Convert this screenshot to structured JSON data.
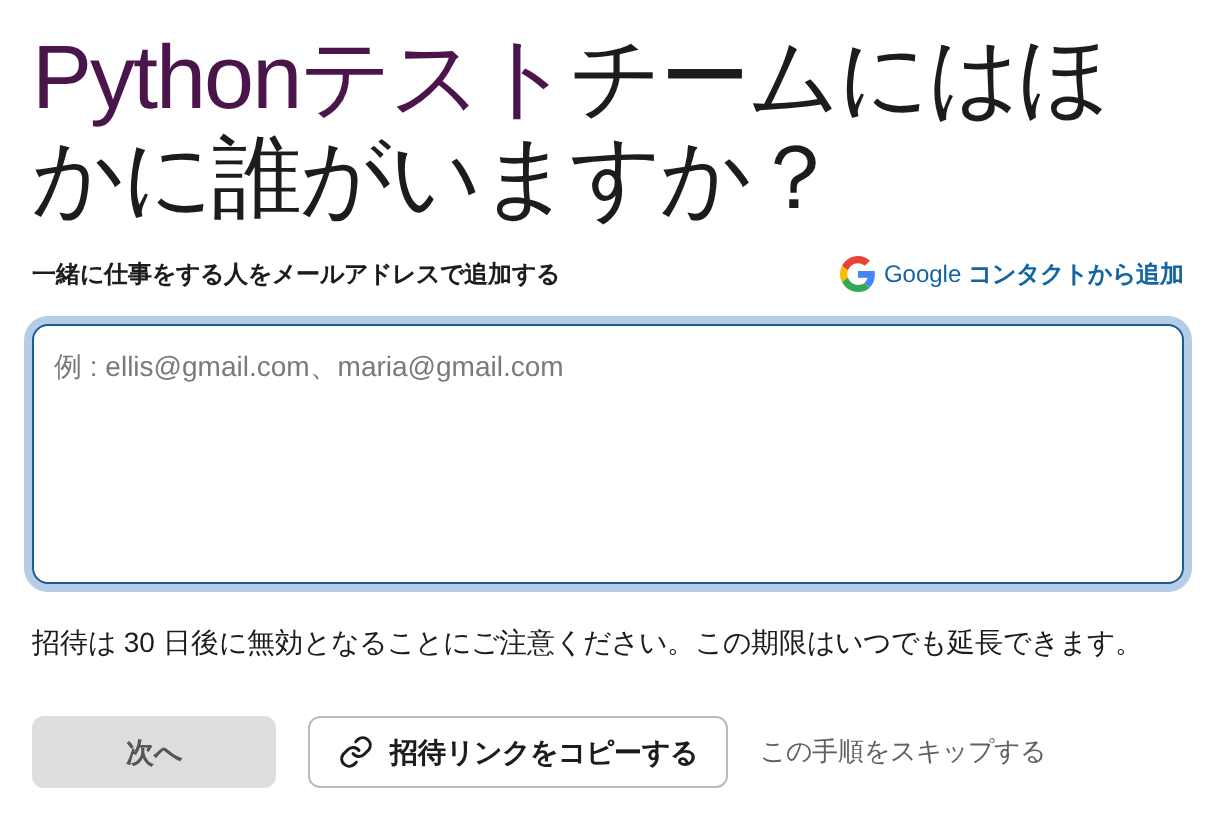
{
  "title": [
    {
      "kind": "team",
      "text": "Pythonテスト"
    },
    {
      "kind": "plain",
      "text": "チームにはほかに誰がいますか？"
    }
  ],
  "email_label": "一緒に仕事をする人をメールアドレスで追加する",
  "google_link": {
    "brand": "Google",
    "text": "コンタクトから追加"
  },
  "email_field": {
    "placeholder": "例 : ellis@gmail.com、maria@gmail.com",
    "focused": true
  },
  "note": "招待は 30 日後に無効となることにご注意ください。この期限はいつでも延長できます。",
  "next_button": {
    "label": "次へ",
    "disabled": true
  },
  "copy_button": {
    "label": "招待リンクをコピーする"
  },
  "skip_link": "この手順をスキップする"
}
